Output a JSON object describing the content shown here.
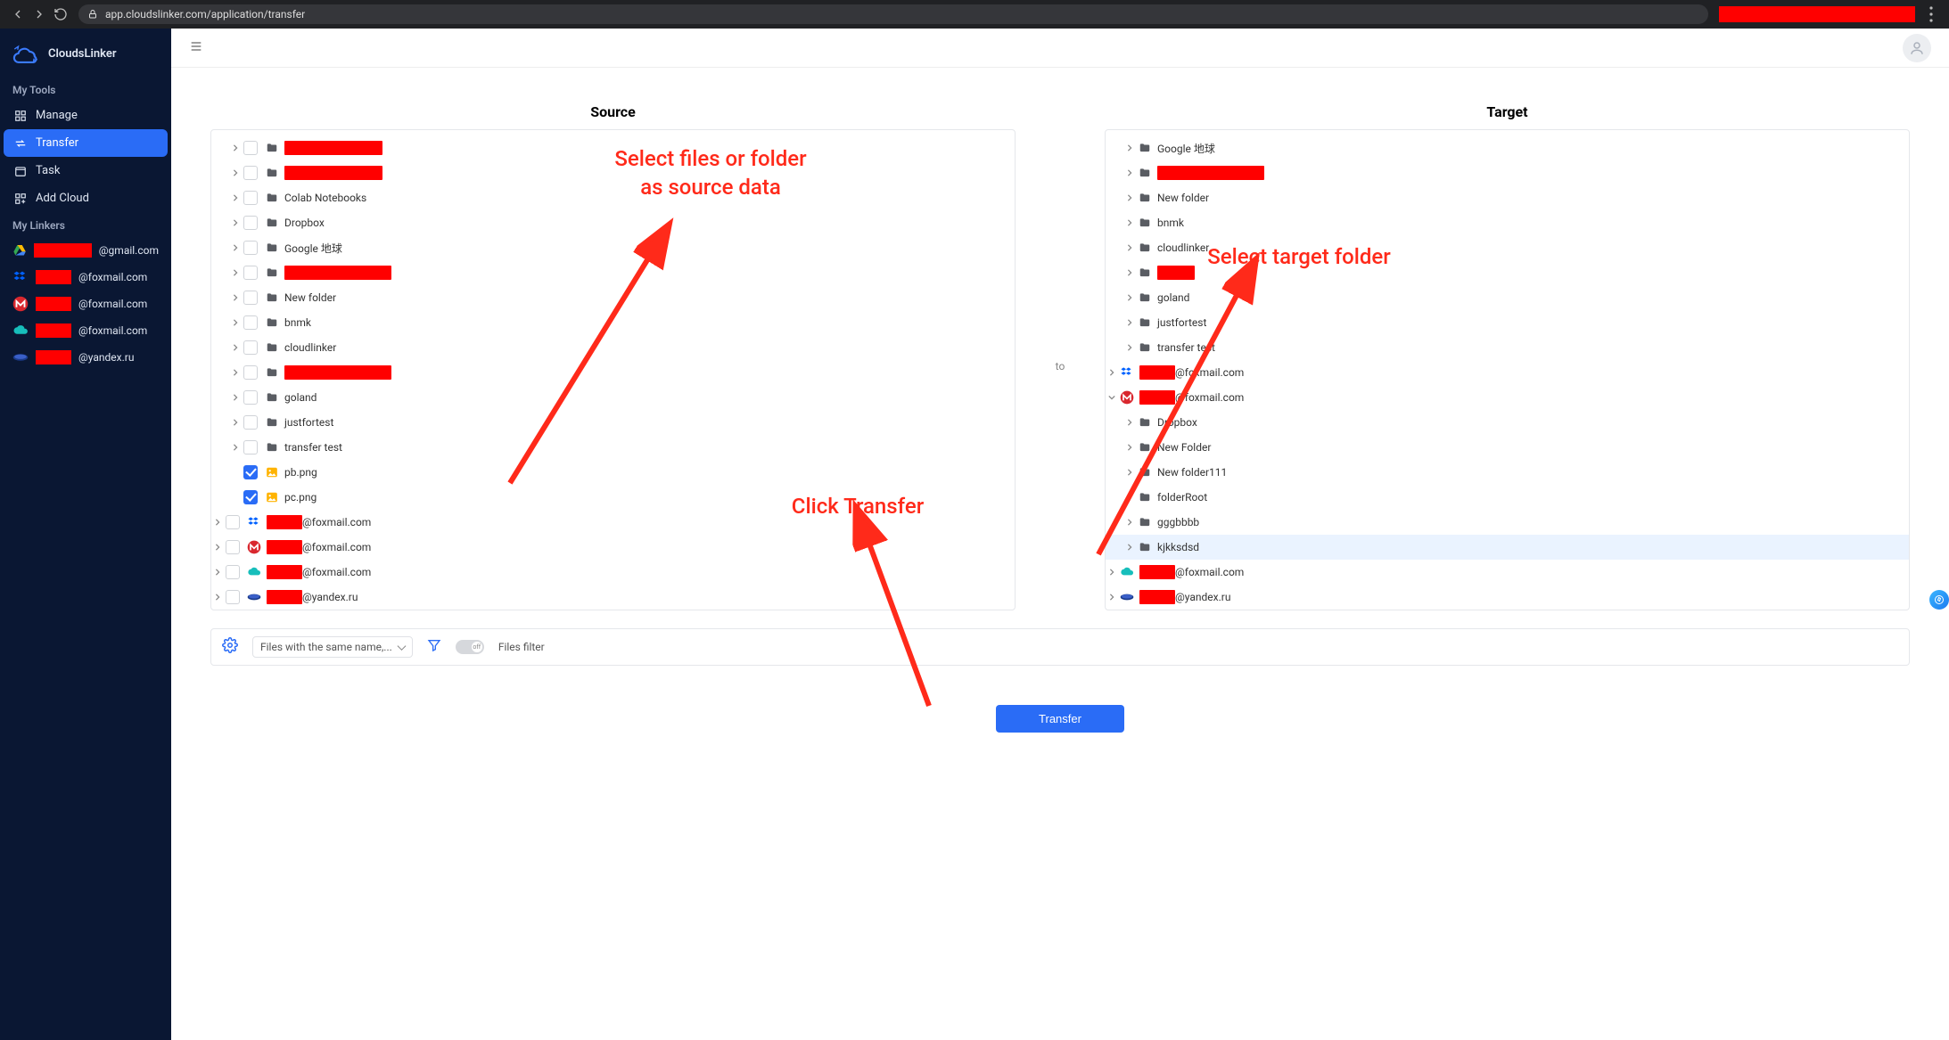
{
  "browser": {
    "url": "app.cloudslinker.com/application/transfer"
  },
  "brand": {
    "name": "CloudsLinker"
  },
  "sidebar": {
    "section_tools": "My Tools",
    "section_linkers": "My Linkers",
    "items": {
      "manage": "Manage",
      "transfer": "Transfer",
      "task": "Task",
      "add_cloud": "Add Cloud"
    },
    "linkers": [
      {
        "brand": "gdrive",
        "suffix": "@gmail.com",
        "red_w": 72
      },
      {
        "brand": "dropbox",
        "suffix": "@foxmail.com",
        "red_w": 40
      },
      {
        "brand": "mega",
        "suffix": "@foxmail.com",
        "red_w": 40
      },
      {
        "brand": "pcloud",
        "suffix": "@foxmail.com",
        "red_w": 40
      },
      {
        "brand": "yandex",
        "suffix": "@yandex.ru",
        "red_w": 40
      }
    ]
  },
  "main": {
    "source_title": "Source",
    "target_title": "Target",
    "to_label": "to",
    "options": {
      "select_label": "Files with the same name,...",
      "files_filter": "Files filter",
      "toggle_state": "off"
    },
    "transfer_button": "Transfer"
  },
  "source_tree": [
    {
      "indent": 1,
      "caret": true,
      "cb": "unchecked",
      "icon": "folder",
      "redact_w": 110
    },
    {
      "indent": 1,
      "caret": true,
      "cb": "unchecked",
      "icon": "folder",
      "redact_w": 110
    },
    {
      "indent": 1,
      "caret": true,
      "cb": "unchecked",
      "icon": "folder",
      "label": "Colab Notebooks"
    },
    {
      "indent": 1,
      "caret": true,
      "cb": "unchecked",
      "icon": "folder",
      "label": "Dropbox"
    },
    {
      "indent": 1,
      "caret": true,
      "cb": "unchecked",
      "icon": "folder",
      "label": "Google 地球"
    },
    {
      "indent": 1,
      "caret": true,
      "cb": "unchecked",
      "icon": "folder",
      "redact_w": 120
    },
    {
      "indent": 1,
      "caret": true,
      "cb": "unchecked",
      "icon": "folder",
      "label": "New folder"
    },
    {
      "indent": 1,
      "caret": true,
      "cb": "unchecked",
      "icon": "folder",
      "label": "bnmk"
    },
    {
      "indent": 1,
      "caret": true,
      "cb": "unchecked",
      "icon": "folder",
      "label": "cloudlinker"
    },
    {
      "indent": 1,
      "caret": true,
      "cb": "unchecked",
      "icon": "folder",
      "redact_w": 120
    },
    {
      "indent": 1,
      "caret": true,
      "cb": "unchecked",
      "icon": "folder",
      "label": "goland"
    },
    {
      "indent": 1,
      "caret": true,
      "cb": "unchecked",
      "icon": "folder",
      "label": "justfortest"
    },
    {
      "indent": 1,
      "caret": true,
      "cb": "unchecked",
      "icon": "folder",
      "label": "transfer test"
    },
    {
      "indent": 1,
      "caret": false,
      "cb": "checked",
      "icon": "image",
      "label": "pb.png"
    },
    {
      "indent": 1,
      "caret": false,
      "cb": "checked",
      "icon": "image",
      "label": "pc.png"
    },
    {
      "indent": 0,
      "caret": true,
      "cb": "unchecked",
      "icon": "brand-dropbox",
      "redact_w": 40,
      "suffix": "@foxmail.com"
    },
    {
      "indent": 0,
      "caret": true,
      "cb": "unchecked",
      "icon": "brand-mega",
      "redact_w": 40,
      "suffix": "@foxmail.com"
    },
    {
      "indent": 0,
      "caret": true,
      "cb": "unchecked",
      "icon": "brand-pcloud",
      "redact_w": 40,
      "suffix": "@foxmail.com"
    },
    {
      "indent": 0,
      "caret": true,
      "cb": "unchecked",
      "icon": "brand-yandex",
      "redact_w": 40,
      "suffix": "@yandex.ru"
    }
  ],
  "target_tree": [
    {
      "indent": 1,
      "caret": true,
      "icon": "folder",
      "label": "Google 地球"
    },
    {
      "indent": 1,
      "caret": true,
      "icon": "folder",
      "redact_w": 120
    },
    {
      "indent": 1,
      "caret": true,
      "icon": "folder",
      "label": "New folder"
    },
    {
      "indent": 1,
      "caret": true,
      "icon": "folder",
      "label": "bnmk"
    },
    {
      "indent": 1,
      "caret": true,
      "icon": "folder",
      "label": "cloudlinker"
    },
    {
      "indent": 1,
      "caret": true,
      "icon": "folder",
      "redact_w": 42
    },
    {
      "indent": 1,
      "caret": true,
      "icon": "folder",
      "label": "goland"
    },
    {
      "indent": 1,
      "caret": true,
      "icon": "folder",
      "label": "justfortest"
    },
    {
      "indent": 1,
      "caret": true,
      "icon": "folder",
      "label": "transfer test"
    },
    {
      "indent": 0,
      "caret": true,
      "icon": "brand-dropbox",
      "redact_w": 40,
      "suffix": "@foxmail.com"
    },
    {
      "indent": 0,
      "caret_open": true,
      "icon": "brand-mega",
      "redact_w": 40,
      "suffix": "@foxmail.com"
    },
    {
      "indent": 1,
      "caret": true,
      "icon": "folder",
      "label": "Dropbox"
    },
    {
      "indent": 1,
      "caret": true,
      "icon": "folder",
      "label": "New Folder"
    },
    {
      "indent": 1,
      "caret": true,
      "icon": "folder",
      "label": "New folder111"
    },
    {
      "indent": 1,
      "caret": true,
      "icon": "folder",
      "label": "folderRoot"
    },
    {
      "indent": 1,
      "caret": true,
      "icon": "folder",
      "label": "gggbbbb"
    },
    {
      "indent": 1,
      "caret": true,
      "icon": "folder",
      "label": "kjkksdsd",
      "highlight": true
    },
    {
      "indent": 0,
      "caret": true,
      "icon": "brand-pcloud",
      "redact_w": 40,
      "suffix": "@foxmail.com"
    },
    {
      "indent": 0,
      "caret": true,
      "icon": "brand-yandex",
      "redact_w": 40,
      "suffix": "@yandex.ru"
    }
  ],
  "annotations": {
    "src_hint": "Select files or folder as source data",
    "click_hint": "Click Transfer",
    "tgt_hint": "Select target folder"
  }
}
